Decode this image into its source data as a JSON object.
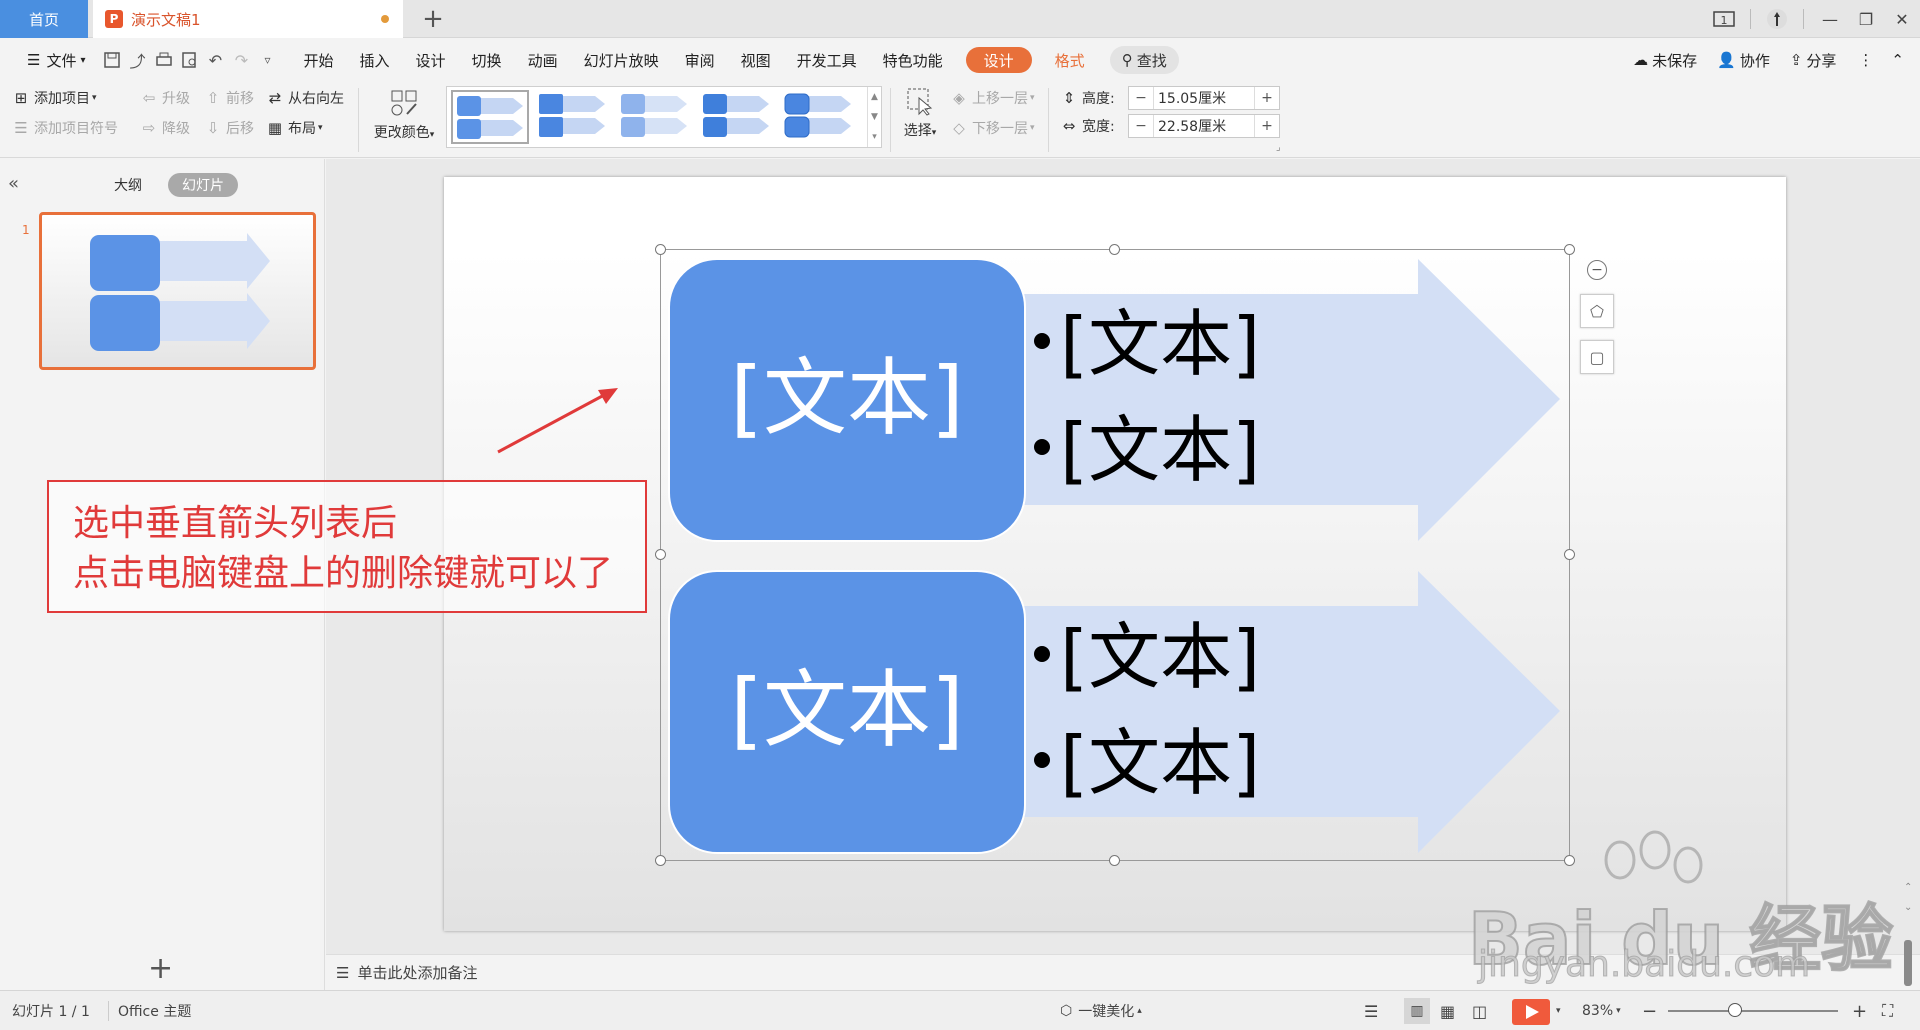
{
  "tabs": {
    "home": "首页",
    "document": "演示文稿1",
    "add": "+"
  },
  "window": {
    "page_indicator": "1"
  },
  "menu": {
    "file": "文件",
    "items": [
      "开始",
      "插入",
      "设计",
      "切换",
      "动画",
      "幻灯片放映",
      "审阅",
      "视图",
      "开发工具",
      "特色功能"
    ],
    "design_active": "设计",
    "format": "格式",
    "search": "查找",
    "unsaved": "未保存",
    "collab": "协作",
    "share": "分享"
  },
  "ribbon": {
    "add_item": "添加项目",
    "add_bullet": "添加项目符号",
    "promote": "升级",
    "demote": "降级",
    "move_forward": "前移",
    "move_back": "后移",
    "right_to_left": "从右向左",
    "layout": "布局",
    "change_color": "更改颜色",
    "select": "选择",
    "bring_forward": "上移一层",
    "send_backward": "下移一层",
    "height_label": "高度:",
    "height_value": "15.05厘米",
    "width_label": "宽度:",
    "width_value": "22.58厘米",
    "minus": "−",
    "plus": "+"
  },
  "left_panel": {
    "outline_tab": "大纲",
    "slides_tab": "幻灯片",
    "slide_number": "1",
    "add_slide": "+"
  },
  "slide": {
    "block1_title": "[文本]",
    "block1_bullets": [
      "[文本]",
      "[文本]"
    ],
    "block2_title": "[文本]",
    "block2_bullets": [
      "[文本]",
      "[文本]"
    ]
  },
  "annotation": {
    "line1": "选中垂直箭头列表后",
    "line2": "点击电脑键盘上的删除键就可以了"
  },
  "notes": {
    "placeholder": "单击此处添加备注"
  },
  "watermark": {
    "brand": "Bai du 经验",
    "url": "jingyan.baidu.com"
  },
  "status": {
    "slide_count": "幻灯片 1 / 1",
    "theme": "Office 主题",
    "beautify": "一键美化",
    "zoom": "83%"
  },
  "colors": {
    "accent": "#e8703a",
    "home_tab": "#4a8fe0",
    "smartart_block": "#5b93e6",
    "smartart_arrow": "#d3dff5",
    "annotation_red": "#e03a3a"
  }
}
